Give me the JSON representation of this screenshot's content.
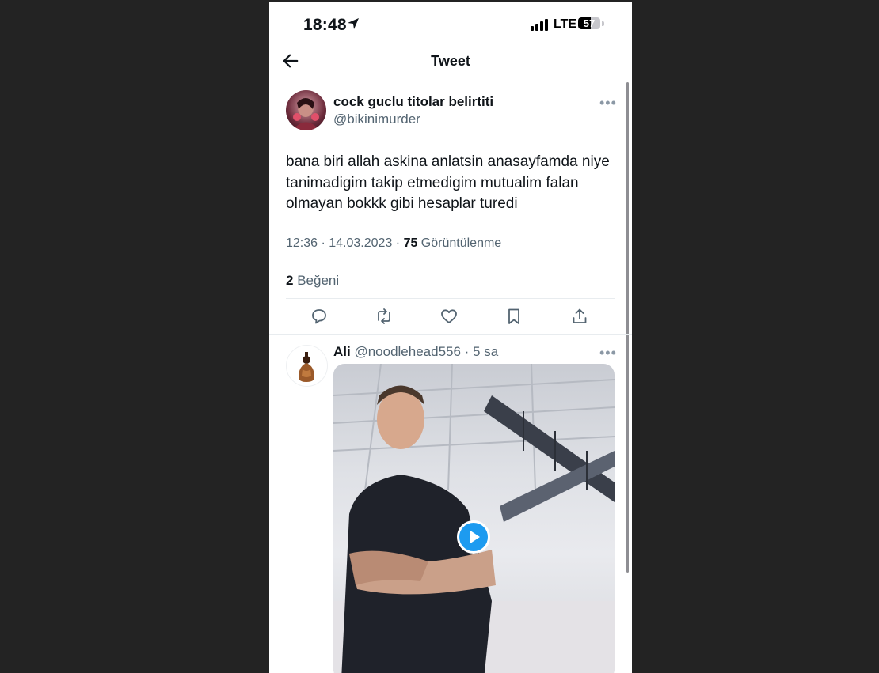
{
  "status_bar": {
    "time": "18:48",
    "network": "LTE",
    "battery_level": "57",
    "battery_fraction": 0.57
  },
  "header": {
    "title": "Tweet",
    "back_icon": "arrow-left-icon"
  },
  "tweet": {
    "author_name": "cock guclu titolar belirtiti",
    "author_handle": "@bikinimurder",
    "text": "bana biri allah askina anlatsin anasayfamda niye tanimadigim takip etmedigim mutualim falan olmayan bokkk gibi hesaplar turedi",
    "time": "12:36 · 14.03.2023 · ",
    "views_count": "75",
    "views_label": " Görüntülenme",
    "likes_count": "2",
    "likes_label": " Beğeni",
    "actions": [
      "reply-icon",
      "retweet-icon",
      "like-icon",
      "bookmark-icon",
      "share-icon"
    ]
  },
  "reply": {
    "author_name": "Ali",
    "author_handle": " @noodlehead556 · 5 sa",
    "media_type": "video",
    "play_icon": "play-icon"
  },
  "colors": {
    "text_primary": "#0f1419",
    "text_secondary": "#536471",
    "accent": "#1d9bf0",
    "background_outer": "#232323"
  }
}
